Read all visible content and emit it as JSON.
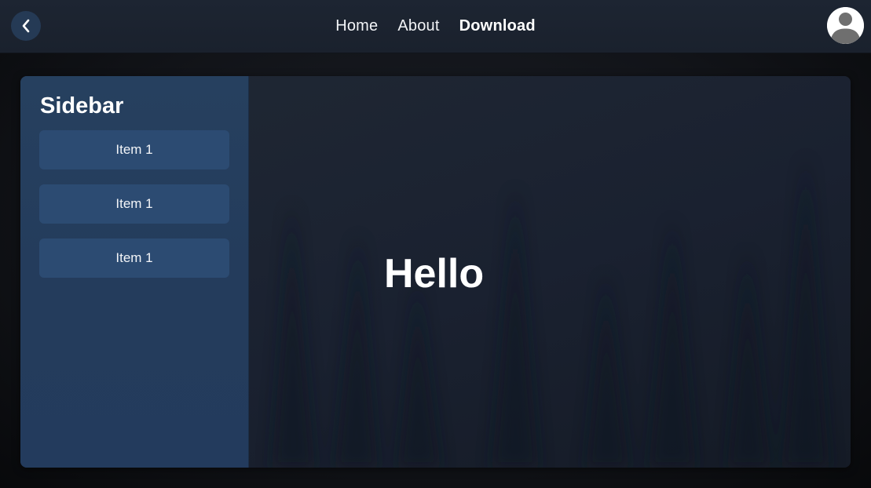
{
  "header": {
    "back_icon": "chevron-left-icon",
    "nav": [
      {
        "label": "Home",
        "active": false
      },
      {
        "label": "About",
        "active": false
      },
      {
        "label": "Download",
        "active": true
      }
    ],
    "avatar_icon": "user-avatar-icon"
  },
  "sidebar": {
    "title": "Sidebar",
    "items": [
      {
        "label": "Item 1"
      },
      {
        "label": "Item 1"
      },
      {
        "label": "Item 1"
      }
    ]
  },
  "main": {
    "heading": "Hello"
  },
  "colors": {
    "topbar": "#1d2532",
    "sidebar": "#26405f",
    "sidebar_item": "#2c4b72",
    "back_button": "#253a55",
    "text": "#ffffff"
  }
}
